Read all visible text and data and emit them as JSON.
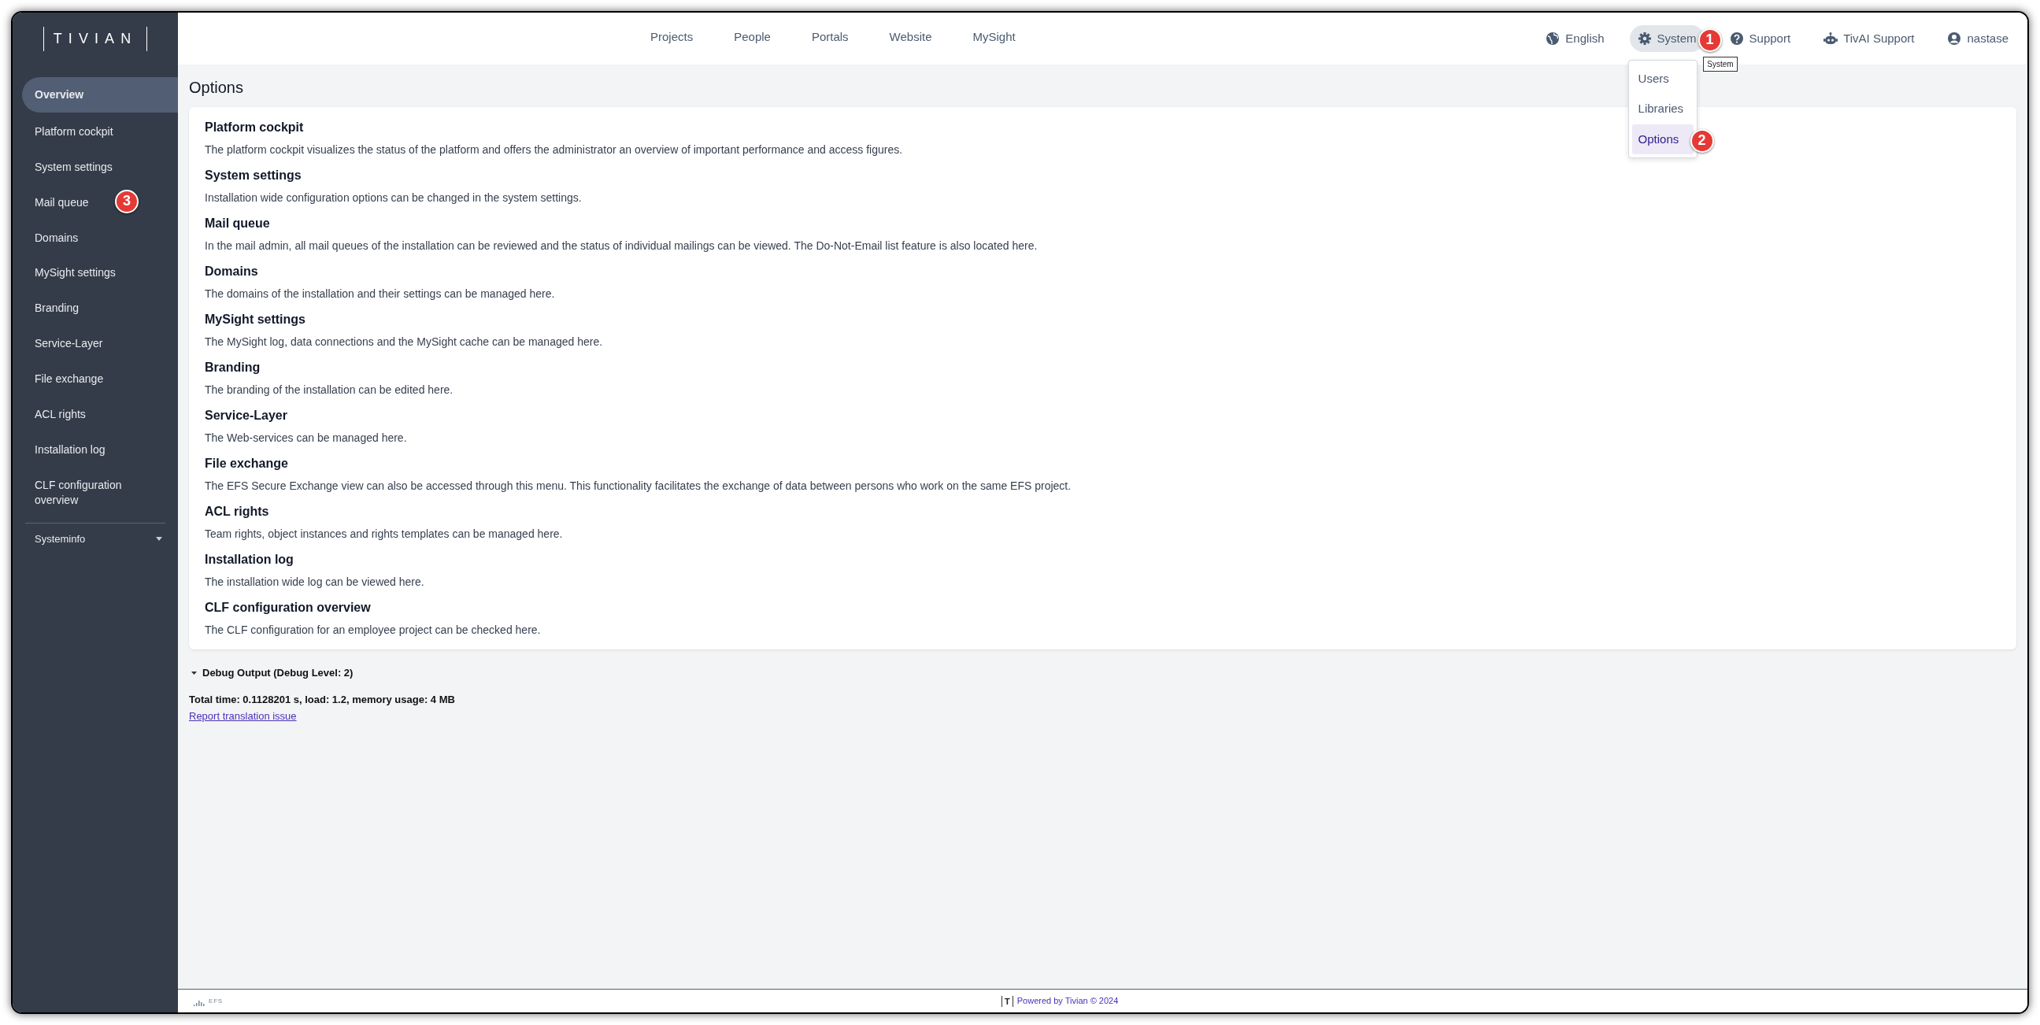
{
  "logo": "TIVIAN",
  "sidebar": {
    "items": [
      {
        "label": "Overview",
        "selected": true
      },
      {
        "label": "Platform cockpit",
        "selected": false
      },
      {
        "label": "System settings",
        "selected": false
      },
      {
        "label": "Mail queue",
        "selected": false,
        "badge": "3"
      },
      {
        "label": "Domains",
        "selected": false
      },
      {
        "label": "MySight settings",
        "selected": false
      },
      {
        "label": "Branding",
        "selected": false
      },
      {
        "label": "Service-Layer",
        "selected": false
      },
      {
        "label": "File exchange",
        "selected": false
      },
      {
        "label": "ACL rights",
        "selected": false
      },
      {
        "label": "Installation log",
        "selected": false
      },
      {
        "label": "CLF configuration overview",
        "selected": false
      }
    ],
    "section": {
      "label": "Systeminfo",
      "expanded": false
    }
  },
  "nav": [
    "Projects",
    "People",
    "Portals",
    "Website",
    "MySight"
  ],
  "header_actions": [
    {
      "kind": "language",
      "label": "English",
      "active": false
    },
    {
      "kind": "system",
      "label": "System",
      "active": true,
      "badge": "1",
      "tooltip": "System"
    },
    {
      "kind": "help",
      "label": "Support",
      "active": false
    },
    {
      "kind": "bot",
      "label": "TivAI Support",
      "active": false
    },
    {
      "kind": "user",
      "label": "nastase",
      "active": false
    }
  ],
  "system_menu": {
    "items": [
      {
        "label": "Users",
        "selected": false
      },
      {
        "label": "Libraries",
        "selected": false
      },
      {
        "label": "Options",
        "selected": true,
        "badge": "2"
      }
    ]
  },
  "page_title": "Options",
  "options": [
    {
      "title": "Platform cockpit",
      "description": "The platform cockpit visualizes the status of the platform and offers the administrator an overview of important performance and access figures."
    },
    {
      "title": "System settings",
      "description": "Installation wide configuration options can be changed in the system settings."
    },
    {
      "title": "Mail queue",
      "description": "In the mail admin, all mail queues of the installation can be reviewed and the status of individual mailings can be viewed. The Do-Not-Email list feature is also located here."
    },
    {
      "title": "Domains",
      "description": "The domains of the installation and their settings can be managed here."
    },
    {
      "title": "MySight settings",
      "description": "The MySight log, data connections and the MySight cache can be managed here."
    },
    {
      "title": "Branding",
      "description": "The branding of the installation can be edited here."
    },
    {
      "title": "Service-Layer",
      "description": "The Web-services can be managed here."
    },
    {
      "title": "File exchange",
      "description": "The EFS Secure Exchange view can also be accessed through this menu. This functionality facilitates the exchange of data between persons who work on the same EFS project."
    },
    {
      "title": "ACL rights",
      "description": "Team rights, object instances and rights templates can be managed here."
    },
    {
      "title": "Installation log",
      "description": "The installation wide log can be viewed here."
    },
    {
      "title": "CLF configuration overview",
      "description": "The CLF configuration for an employee project can be checked here."
    }
  ],
  "debug": {
    "label": "Debug Output (Debug Level: 2)",
    "expanded": true,
    "summary": "Total time: 0.1128201 s, load: 1.2, memory usage: 4 MB",
    "link": "Report translation issue"
  },
  "footer": {
    "product": "EFS",
    "logo_mark": "T",
    "powered_by": "Powered by Tivian © 2024"
  }
}
